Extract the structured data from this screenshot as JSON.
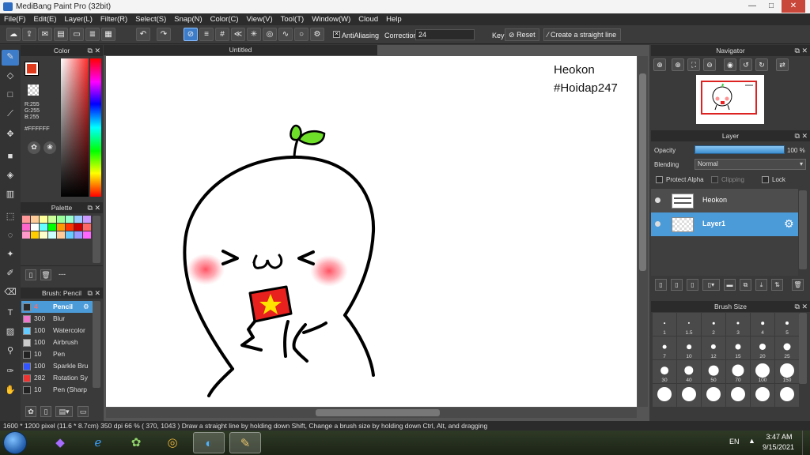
{
  "window": {
    "title": "MediBang Paint Pro (32bit)",
    "min": "—",
    "max": "□",
    "close": "✕"
  },
  "menu": [
    "File(F)",
    "Edit(E)",
    "Layer(L)",
    "Filter(R)",
    "Select(S)",
    "Snap(N)",
    "Color(C)",
    "View(V)",
    "Tool(T)",
    "Window(W)",
    "Cloud",
    "Help"
  ],
  "toolbar": {
    "antialiasing_label": "AntiAliasing",
    "antialiasing_checked": true,
    "correction_label": "Correction",
    "correction_value": "24",
    "key_label": "Key",
    "reset_label": "Reset",
    "straight_label": "Create a straight line"
  },
  "color_panel": {
    "title": "Color",
    "primary": "#e03a1c",
    "secondary": "#ff7f00",
    "rgb": [
      "R:255",
      "G:255",
      "B:255"
    ],
    "hex": "#FFFFFF"
  },
  "palette_panel": {
    "title": "Palette",
    "colors": [
      "#ff9999",
      "#ffcc99",
      "#ffff99",
      "#ccff99",
      "#99ff99",
      "#99ffcc",
      "#99ccff",
      "#cc99ff",
      "#ff66cc",
      "#ffffff",
      "#66ffff",
      "#00ff00",
      "#ff9900",
      "#ff3300",
      "#cc0000",
      "#ff6666",
      "#ff99cc",
      "#ffcc00",
      "#ffffcc",
      "#ccffff",
      "#ffcc99",
      "#66ccff",
      "#9999ff",
      "#ff66ff"
    ],
    "footer_text": "---"
  },
  "brush_panel": {
    "title": "Brush: Pencil",
    "items": [
      {
        "size": "4",
        "name": "Pencil",
        "color": "#2a2a2a",
        "selected": true
      },
      {
        "size": "300",
        "name": "Blur",
        "color": "#ee77cc"
      },
      {
        "size": "100",
        "name": "Watercolor",
        "color": "#66ccff"
      },
      {
        "size": "100",
        "name": "Airbrush",
        "color": "#cccccc"
      },
      {
        "size": "10",
        "name": "Pen",
        "color": "#222222"
      },
      {
        "size": "100",
        "name": "Sparkle Bru",
        "color": "#3355ff"
      },
      {
        "size": "282",
        "name": "Rotation Sy",
        "color": "#ee3333"
      },
      {
        "size": "10",
        "name": "Pen (Sharp",
        "color": "#222222"
      }
    ]
  },
  "document": {
    "tab": "Untitled",
    "text_line1": "Heokon",
    "text_line2": "#Hoidap247"
  },
  "navigator": {
    "title": "Navigator"
  },
  "layer_panel": {
    "title": "Layer",
    "opacity_label": "Opacity",
    "opacity_value": "100 %",
    "blending_label": "Blending",
    "blending_value": "Normal",
    "protect_alpha": "Protect Alpha",
    "clipping": "Clipping",
    "lock": "Lock",
    "layers": [
      {
        "name": "Heokon",
        "selected": false
      },
      {
        "name": "Layer1",
        "selected": true
      }
    ]
  },
  "brush_size_panel": {
    "title": "Brush Size",
    "sizes": [
      "1",
      "1.5",
      "2",
      "3",
      "4",
      "5",
      "7",
      "10",
      "12",
      "15",
      "20",
      "25",
      "30",
      "40",
      "50",
      "70",
      "100",
      "150",
      "",
      "",
      "",
      "",
      "",
      ""
    ]
  },
  "status": "1600 * 1200 pixel   (11.6 * 8.7cm)   350 dpi   66 %   ( 370, 1043 )   Draw a straight line by holding down Shift, Change a brush size by holding down Ctrl, Alt, and dragging",
  "taskbar": {
    "lang": "EN",
    "time": "3:47 AM",
    "date": "9/15/2021"
  }
}
